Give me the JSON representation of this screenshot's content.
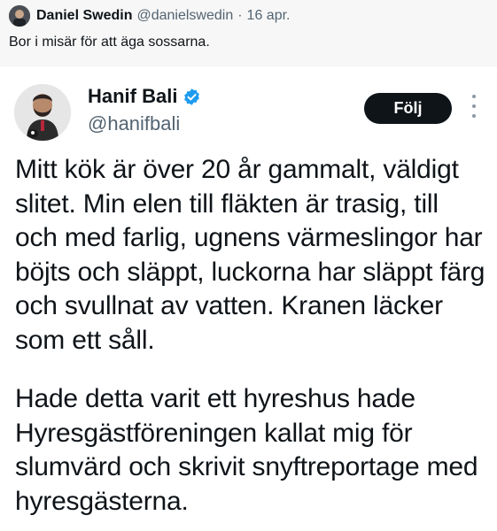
{
  "quote": {
    "author_name": "Daniel Swedin",
    "author_handle": "@danielswedin",
    "separator": "·",
    "date": "16 apr.",
    "text": "Bor i misär för att äga sossarna."
  },
  "post": {
    "author_name": "Hanif Bali",
    "author_handle": "@hanifbali",
    "follow_label": "Följ",
    "paragraph1": [
      "Mitt kök är över 20 år gammalt, väldigt",
      "slitet. Min elen till fläkten är trasig, till",
      "och med farlig, ugnens värmeslingor har",
      "böjts och släppt, luckorna har släppt färg",
      "och svullnat av vatten. Kranen läcker",
      "som ett såll."
    ],
    "paragraph2": [
      "Hade detta varit ett hyreshus hade",
      "Hyresgästföreningen kallat mig för",
      "slumvärd och skrivit snyftreportage med",
      "hyresgästerna."
    ]
  },
  "colors": {
    "verified_badge": "#1d9bf0",
    "follow_button_bg": "#0f1419",
    "secondary_text": "#536471",
    "quote_header_bg": "#f7f7f7"
  },
  "icons": [
    "avatar",
    "verified-badge-icon",
    "more-options-icon"
  ]
}
